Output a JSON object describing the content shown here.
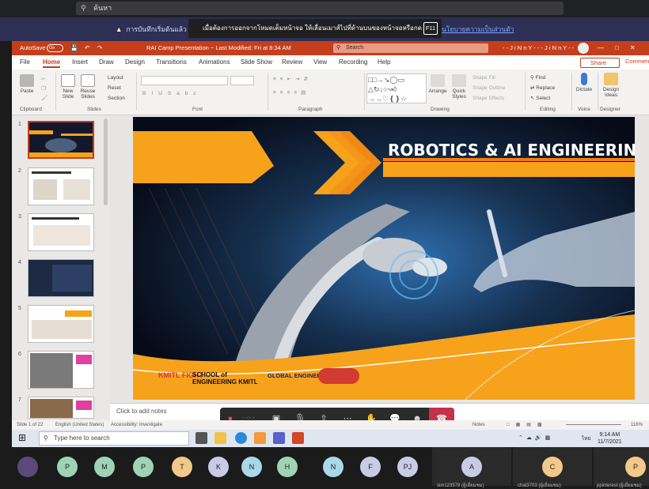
{
  "meeting": {
    "search_placeholder": "ค้นหา",
    "notice_text": "การบันทึกเริ่มต้นแล้ว ทำลั",
    "fullscreen_tip": "เมื่อต้องการออกจากโหมดเต็มหน้าจอ ให้เลื่อนเมาส์ไปที่ด้านบนของหน้าจอหรือกด",
    "fullscreen_key": "F11",
    "notice_link": "นโยบายความเป็นส่วนตัว",
    "participants": [
      {
        "initial": "P",
        "color": "#9fd3b7"
      },
      {
        "initial": "M",
        "color": "#9fd3b7"
      },
      {
        "initial": "P",
        "color": "#9fd3b7"
      },
      {
        "initial": "T",
        "color": "#f2c98a"
      },
      {
        "initial": "K",
        "color": "#c9cbe6"
      },
      {
        "initial": "N",
        "color": "#a9d8e8"
      },
      {
        "initial": "H",
        "color": "#9fd3b7"
      },
      {
        "initial": "N",
        "color": "#a9d8e8"
      },
      {
        "initial": "F",
        "color": "#c9cbe6"
      },
      {
        "initial": "PJ",
        "color": "#c9cbe6"
      }
    ],
    "tiles": [
      {
        "initial": "A",
        "color": "#c9cbe6",
        "label": "sim123578 (ผู้เยี่ยมชม)"
      },
      {
        "initial": "C",
        "color": "#f2c98a",
        "label": "chat3703 (ผู้เยี่ยมชม)"
      },
      {
        "initial": "P",
        "color": "#f2c98a",
        "label": "ppinterest (ผู้เยี่ยมชม)"
      }
    ]
  },
  "ppt": {
    "autosave_label": "AutoSave",
    "autosave_state": "On",
    "title": "RAI Camp Presentation  ~  Last Modified: Fri at 8:34 AM",
    "search": "Search",
    "user": "- - J i N n Y - - -  J i N n Y - -",
    "tabs": [
      "File",
      "Home",
      "Insert",
      "Draw",
      "Design",
      "Transitions",
      "Animations",
      "Slide Show",
      "Review",
      "View",
      "Recording",
      "Help"
    ],
    "active_tab": "Home",
    "share": "Share",
    "comments": "Comments",
    "ribbon": {
      "paste": "Paste",
      "new_slide": "New Slide",
      "reuse_slides": "Reuse Slides",
      "layout": "Layout",
      "reset": "Reset",
      "section": "Section",
      "arrange": "Arrange",
      "quick_styles": "Quick Styles",
      "shape_fill": "Shape Fill",
      "shape_outline": "Shape Outline",
      "shape_effects": "Shape Effects",
      "find": "Find",
      "replace": "Replace",
      "select": "Select",
      "dictate": "Dictate",
      "design_ideas": "Design Ideas",
      "groups": [
        "Clipboard",
        "Slides",
        "Font",
        "Paragraph",
        "Drawing",
        "Editing",
        "Voice",
        "Designer"
      ]
    },
    "slide_numbers": [
      "1",
      "2",
      "3",
      "4",
      "5",
      "6",
      "7"
    ],
    "slide": {
      "title": "ROBOTICS & AI ENGINEERING",
      "logo_1": "KMITL FIGHT",
      "logo_2": "SCHOOL of ENGINEERING KMITL",
      "logo_3": "GLOBAL ENGINEER"
    },
    "notes_placeholder": "Click to add notes",
    "status": {
      "slide_of": "Slide 1 of 22",
      "language": "English (United States)",
      "accessibility": "Accessibility: Investigate",
      "notes": "Notes",
      "zoom": "116%"
    }
  },
  "taskbar": {
    "search_placeholder": "Type here to search",
    "time": "9:14 AM",
    "date": "11/7/2021",
    "lang": "ไทย"
  },
  "colors": {
    "ppt_brand": "#c43e1c",
    "slide_orange": "#f7a21b",
    "hangup": "#c4314b"
  }
}
